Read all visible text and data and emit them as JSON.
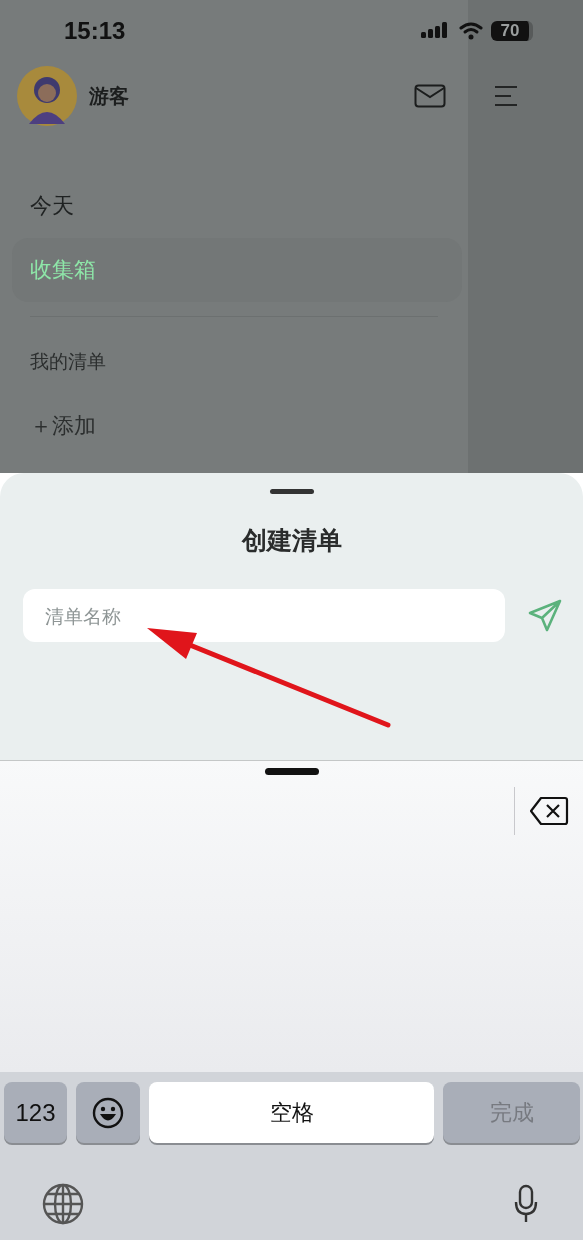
{
  "status_bar": {
    "time": "15:13",
    "battery": "70"
  },
  "header": {
    "user_name": "游客"
  },
  "sidebar": {
    "items": [
      {
        "label": "今天",
        "selected": false
      },
      {
        "label": "收集箱",
        "selected": true
      }
    ],
    "section_title": "我的清单",
    "add_label": "＋添加"
  },
  "sheet": {
    "title": "创建清单",
    "input": {
      "placeholder": "清单名称"
    }
  },
  "keyboard": {
    "keys": [
      {
        "kind": "text",
        "label": "123",
        "disabled": false
      },
      {
        "kind": "emoji",
        "disabled": false
      },
      {
        "kind": "space",
        "label": "空格",
        "disabled": false
      },
      {
        "kind": "text",
        "label": "完成",
        "disabled": true
      }
    ]
  }
}
